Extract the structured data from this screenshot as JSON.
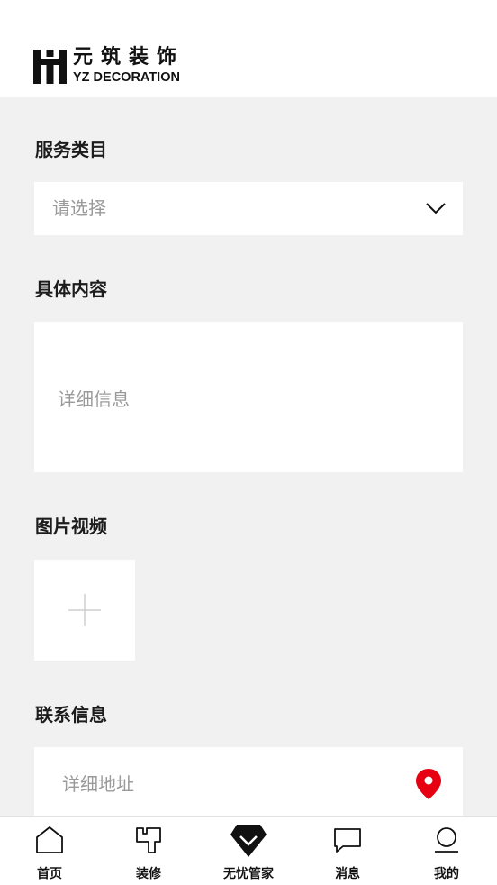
{
  "brand": {
    "name_cn": "元筑装饰",
    "name_en": "YZ DECORATION"
  },
  "form": {
    "service_category": {
      "label": "服务类目",
      "placeholder": "请选择"
    },
    "content": {
      "label": "具体内容",
      "placeholder": "详细信息"
    },
    "media": {
      "label": "图片视频"
    },
    "contact": {
      "label": "联系信息",
      "address_placeholder": "详细地址"
    }
  },
  "tabbar": {
    "items": [
      {
        "label": "首页",
        "icon": "home-icon"
      },
      {
        "label": "装修",
        "icon": "decoration-icon"
      },
      {
        "label": "无忧管家",
        "icon": "butler-icon"
      },
      {
        "label": "消息",
        "icon": "message-icon"
      },
      {
        "label": "我的",
        "icon": "profile-icon"
      }
    ]
  },
  "colors": {
    "background": "#f1f1f1",
    "card": "#ffffff",
    "text": "#1a1a1a",
    "placeholder": "#9a9a9a",
    "accent_pin": "#e60012"
  }
}
